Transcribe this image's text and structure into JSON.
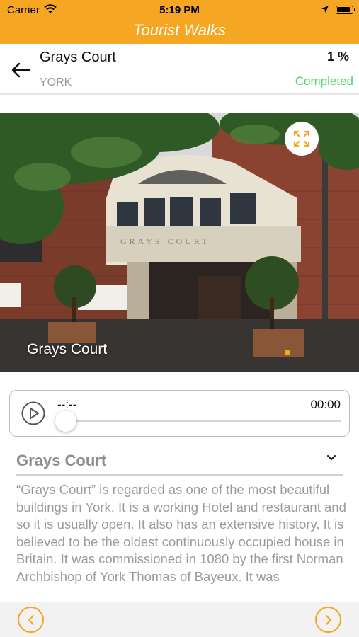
{
  "status_bar": {
    "carrier": "Carrier",
    "time": "5:19 PM",
    "battery_level": 0.9
  },
  "nav": {
    "title": "Tourist Walks"
  },
  "walk": {
    "name": "Grays Court",
    "city": "YORK",
    "progress": "1 %",
    "status": "Completed",
    "status_color": "#4cd964"
  },
  "gallery": {
    "caption": "Grays Court",
    "page_count": 1,
    "current_page": 1
  },
  "player": {
    "elapsed": "--:--",
    "duration": "00:00",
    "position": 0
  },
  "stop": {
    "title": "Grays Court",
    "description": "“Grays Court” is regarded as one of the most beautiful buildings in York. It is  a working Hotel and restaurant and so it is usually open. It also has an extensive history. It is believed to be the oldest continuously occupied house in Britain. It was commissioned in 1080 by the first Norman Archbishop of York Thomas of Bayeux. It was"
  },
  "theme": {
    "accent": "#f5a623",
    "muted_text": "#9b9b9b"
  }
}
